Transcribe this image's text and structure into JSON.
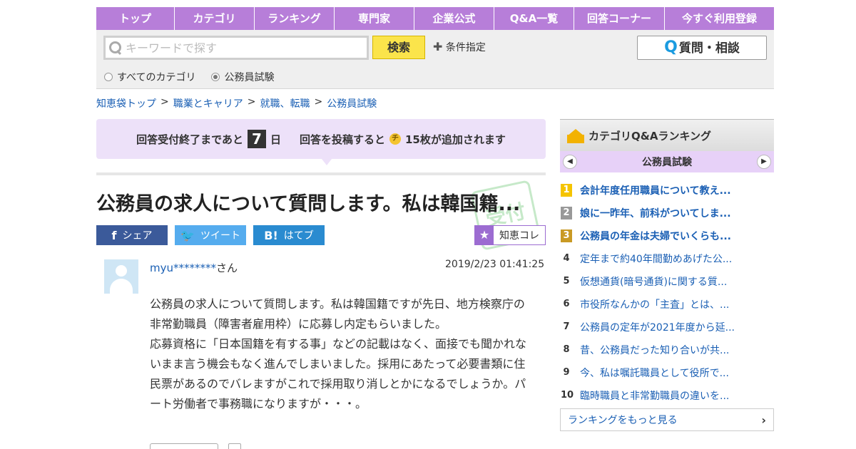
{
  "nav": {
    "items": [
      "トップ",
      "カテゴリ",
      "ランキング",
      "専門家",
      "企業公式",
      "Q&A一覧",
      "回答コーナー",
      "今すぐ利用登録"
    ]
  },
  "search": {
    "placeholder": "キーワードで探す",
    "value": "",
    "button": "検索",
    "condition": "条件指定",
    "ask_button": "質問・相談",
    "radios": [
      {
        "label": "すべてのカテゴリ",
        "selected": false
      },
      {
        "label": "公務員試験",
        "selected": true
      }
    ]
  },
  "breadcrumb": [
    "知恵袋トップ",
    "職業とキャリア",
    "就職、転職",
    "公務員試験"
  ],
  "banner": {
    "prefix": "回答受付終了まであと",
    "days": "7",
    "unit": "日",
    "middle": "回答を投稿すると",
    "coin": "チ",
    "suffix": "15枚が追加されます"
  },
  "question": {
    "title": "公務員の求人について質問します。私は韓国籍...",
    "user": "myu********",
    "user_suffix": "さん",
    "date": "2019/2/23  01:41:25",
    "body": [
      "公務員の求人について質問します。私は韓国籍ですが先日、地方検察庁の非常勤職員（障害者雇用枠）に応募し内定もらいました。",
      "応募資格に「日本国籍を有する事」などの記載はなく、面接でも聞かれないまま言う機会もなく進んでしまいました。採用にあたって必要書類に住民票があるのでバレますがこれで採用取り消しとかになるでしょうか。パート労働者で事務職になりますが・・・。"
    ]
  },
  "share": {
    "facebook": "シェア",
    "twitter": "ツイート",
    "hatena": "はてブ",
    "kore": "知恵コレ"
  },
  "ranking": {
    "title": "カテゴリQ&Aランキング",
    "category": "公務員試験",
    "items": [
      {
        "rank": "1",
        "text": "会計年度任用職員について教え..."
      },
      {
        "rank": "2",
        "text": "娘に一昨年、前科がついてしま..."
      },
      {
        "rank": "3",
        "text": "公務員の年金は夫婦でいくらも..."
      },
      {
        "rank": "4",
        "text": "定年まで約40年間勤めあげた公..."
      },
      {
        "rank": "5",
        "text": "仮想通貨(暗号通貨)に関する質..."
      },
      {
        "rank": "6",
        "text": "市役所なんかの「主査」とは、..."
      },
      {
        "rank": "7",
        "text": "公務員の定年が2021年度から延..."
      },
      {
        "rank": "8",
        "text": "昔、公務員だった知り合いが共..."
      },
      {
        "rank": "9",
        "text": "今、私は嘱託職員として役所で..."
      },
      {
        "rank": "10",
        "text": "臨時職員と非常勤職員の違いを..."
      }
    ],
    "more": "ランキングをもっと見る"
  }
}
